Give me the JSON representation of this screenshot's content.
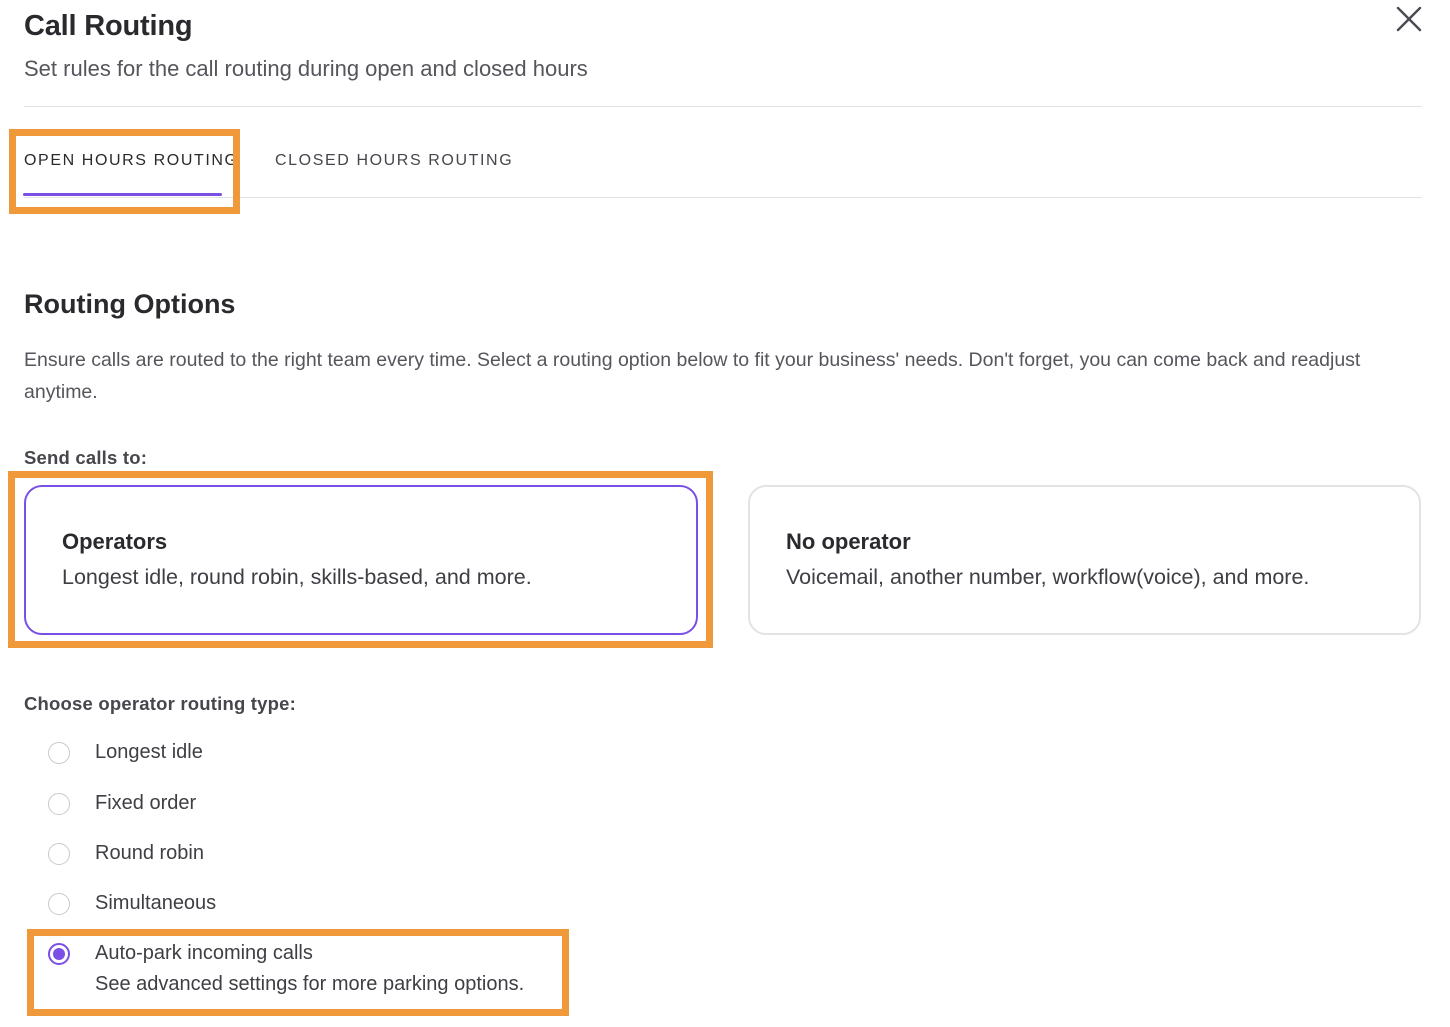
{
  "header": {
    "title": "Call Routing",
    "subtitle": "Set rules for the call routing during open and closed hours"
  },
  "icons": {
    "close": "close-icon"
  },
  "tabs": [
    {
      "label": "OPEN HOURS ROUTING",
      "active": true
    },
    {
      "label": "CLOSED HOURS ROUTING",
      "active": false
    }
  ],
  "routing": {
    "title": "Routing Options",
    "description": "Ensure calls are routed to the right team every time. Select a routing option below to fit your business' needs. Don't forget, you can come back and readjust anytime.",
    "send_calls_label": "Send calls to:",
    "options": [
      {
        "title": "Operators",
        "description": "Longest idle, round robin, skills-based, and more.",
        "selected": true
      },
      {
        "title": "No operator",
        "description": "Voicemail, another number, workflow(voice), and more.",
        "selected": false
      }
    ],
    "routing_type_label": "Choose operator routing type:",
    "types": [
      {
        "label": "Longest idle",
        "selected": false
      },
      {
        "label": "Fixed order",
        "selected": false
      },
      {
        "label": "Round robin",
        "selected": false
      },
      {
        "label": "Simultaneous",
        "selected": false
      },
      {
        "label": "Auto-park incoming calls",
        "sublabel": "See advanced settings for more parking options.",
        "selected": true
      }
    ]
  },
  "colors": {
    "accent": "#7b4fe6",
    "highlight": "#f0993a",
    "border": "#e3e3e6"
  }
}
